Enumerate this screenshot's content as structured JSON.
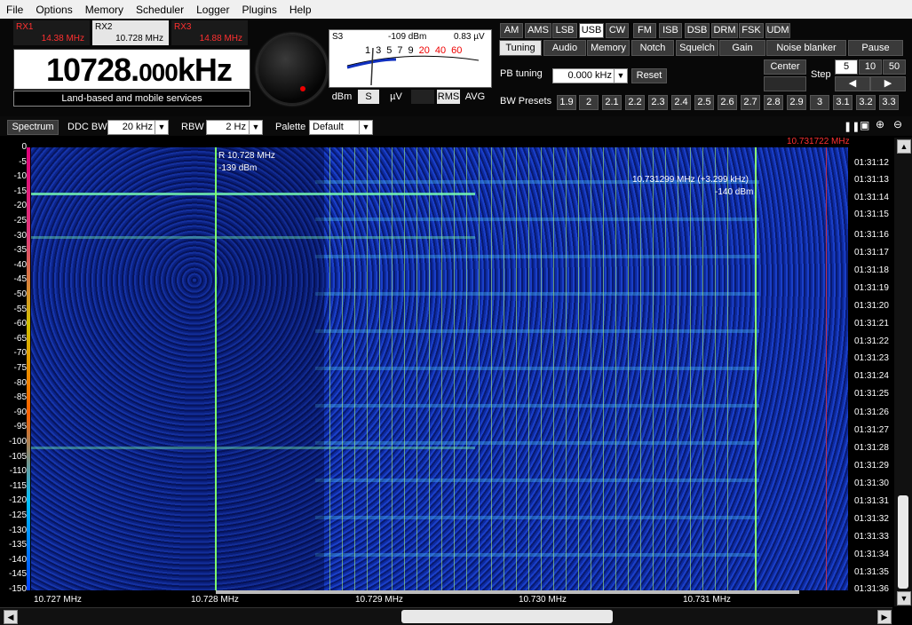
{
  "menu": [
    "File",
    "Options",
    "Memory",
    "Scheduler",
    "Logger",
    "Plugins",
    "Help"
  ],
  "receivers": [
    {
      "name": "RX1",
      "freq": "14.38 MHz"
    },
    {
      "name": "RX2",
      "freq": "10.728 MHz"
    },
    {
      "name": "RX3",
      "freq": "14.88 MHz"
    }
  ],
  "frequency": {
    "main": "10728.",
    "fraction": "000",
    "unit": "kHz"
  },
  "band_label": "Land-based and mobile services",
  "smeter": {
    "s_label": "S3",
    "dbm": "-109 dBm",
    "uv": "0.83 µV",
    "scale": [
      "1",
      "3",
      "5",
      "7",
      "9",
      "20",
      "40",
      "60"
    ]
  },
  "meter_buttons": [
    "dBm",
    "S",
    "µV",
    "",
    "RMS",
    "AVG"
  ],
  "modes": [
    "AM",
    "AMS",
    "LSB",
    "USB",
    "CW",
    "FM",
    "ISB",
    "DSB",
    "DRM",
    "FSK",
    "UDM"
  ],
  "selected_mode": "USB",
  "tabs": [
    "Tuning",
    "Audio",
    "Memory",
    "Notch",
    "Squelch",
    "Gain",
    "Noise blanker",
    "Pause"
  ],
  "pb_tuning": {
    "label": "PB tuning",
    "value": "0.000 kHz",
    "reset": "Reset"
  },
  "center_label": "Center",
  "step": {
    "label": "Step",
    "options": [
      "5",
      "10",
      "50"
    ],
    "selected": "5"
  },
  "bw_presets": {
    "label": "BW Presets",
    "values": [
      "1.9",
      "2",
      "2.1",
      "2.2",
      "2.3",
      "2.4",
      "2.5",
      "2.6",
      "2.7",
      "2.8",
      "2.9",
      "3",
      "3.1",
      "3.2",
      "3.3"
    ]
  },
  "spectrum_toolbar": {
    "spectrum_button": "Spectrum",
    "ddc_bw_label": "DDC BW",
    "ddc_bw_value": "20 kHz",
    "rbw_label": "RBW",
    "rbw_value": "2 Hz",
    "palette_label": "Palette",
    "palette_value": "Default"
  },
  "waterfall": {
    "top_right_freq": "10.731722 MHz",
    "marker_r": "R 10.728 MHz",
    "marker_r_dbm": "-139 dBm",
    "cursor_freq": "10.731299 MHz (+3.299 kHz)",
    "cursor_dbm": "-140 dBm",
    "y_labels": [
      "0",
      "-5",
      "-10",
      "-15",
      "-20",
      "-25",
      "-30",
      "-35",
      "-40",
      "-45",
      "-50",
      "-55",
      "-60",
      "-65",
      "-70",
      "-75",
      "-80",
      "-85",
      "-90",
      "-95",
      "-100",
      "-105",
      "-110",
      "-115",
      "-120",
      "-125",
      "-130",
      "-135",
      "-140",
      "-145",
      "-150"
    ],
    "time_labels": [
      "01:31:12",
      "01:31:13",
      "01:31:14",
      "01:31:15",
      "01:31:16",
      "01:31:17",
      "01:31:18",
      "01:31:19",
      "01:31:20",
      "01:31:21",
      "01:31:22",
      "01:31:23",
      "01:31:24",
      "01:31:25",
      "01:31:26",
      "01:31:27",
      "01:31:28",
      "01:31:29",
      "01:31:30",
      "01:31:31",
      "01:31:32",
      "01:31:33",
      "01:31:34",
      "01:31:35",
      "01:31:36"
    ],
    "x_labels": [
      "10.727 MHz",
      "10.728 MHz",
      "10.729 MHz",
      "10.730 MHz",
      "10.731 MHz"
    ]
  },
  "colors": {
    "accent_red": "#ff3030",
    "panel_bg": "#080808",
    "waterfall_blue": "#0d2aa0"
  }
}
